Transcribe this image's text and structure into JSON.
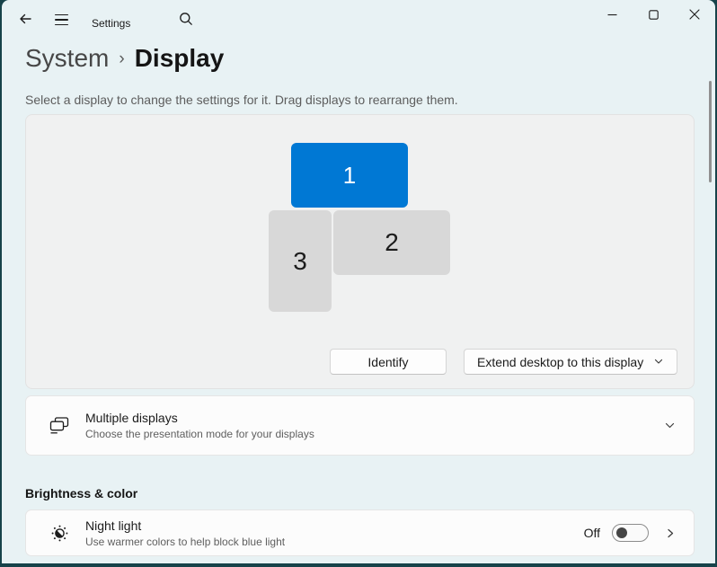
{
  "titlebar": {
    "app_title": "Settings"
  },
  "breadcrumb": {
    "parent": "System",
    "separator": "›",
    "current": "Display"
  },
  "page": {
    "description": "Select a display to change the settings for it. Drag displays to rearrange them."
  },
  "display_arrangement": {
    "monitors": [
      {
        "label": "1",
        "selected": true
      },
      {
        "label": "2",
        "selected": false
      },
      {
        "label": "3",
        "selected": false
      }
    ],
    "identify_button": "Identify",
    "mode_dropdown": "Extend desktop to this display"
  },
  "settings_rows": {
    "multiple_displays": {
      "title": "Multiple displays",
      "subtitle": "Choose the presentation mode for your displays"
    },
    "night_light": {
      "title": "Night light",
      "subtitle": "Use warmer colors to help block blue light",
      "toggle_state": "Off"
    }
  },
  "sections": {
    "brightness_color": "Brightness & color"
  },
  "icons": {
    "back": "arrow-left",
    "menu": "hamburger",
    "search": "magnifier",
    "minimize": "dash",
    "maximize": "square",
    "close": "x",
    "multiple_displays": "two-overlapping-monitors",
    "night_light": "half-moon-sun",
    "expander": "chevron-down",
    "navigate": "chevron-right"
  },
  "colors": {
    "accent": "#0078d4",
    "selected_monitor": "#0078d4",
    "inactive_monitor": "#d8d8d8",
    "page_background": "#e8f2f4",
    "frame_background": "#17434a"
  }
}
